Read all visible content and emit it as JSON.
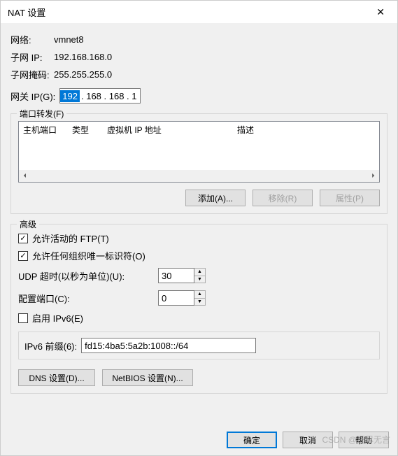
{
  "title": "NAT 设置",
  "close_icon": "✕",
  "network": {
    "label": "网络:",
    "value": "vmnet8"
  },
  "subnet_ip": {
    "label": "子网 IP:",
    "value": "192.168.168.0"
  },
  "subnet_mask": {
    "label": "子网掩码:",
    "value": "255.255.255.0"
  },
  "gateway": {
    "label": "网关 IP(G):",
    "seg0": "192",
    "rest": " . 168 . 168 .   1"
  },
  "port_forward": {
    "legend": "端口转发(F)",
    "headers": {
      "host_port": "主机端口",
      "type": "类型",
      "vm_ip": "虚拟机 IP 地址",
      "desc": "描述"
    },
    "buttons": {
      "add": "添加(A)...",
      "remove": "移除(R)",
      "props": "属性(P)"
    }
  },
  "advanced": {
    "legend": "高级",
    "ftp": "允许活动的 FTP(T)",
    "oui": "允许任何组织唯一标识符(O)",
    "udp_label": "UDP 超时(以秒为单位)(U):",
    "udp_value": "30",
    "cfg_port_label": "配置端口(C):",
    "cfg_port_value": "0",
    "ipv6_enable": "启用 IPv6(E)",
    "ipv6_prefix_label": "IPv6 前缀(6):",
    "ipv6_prefix_value": "fd15:4ba5:5a2b:1008::/64",
    "dns_btn": "DNS 设置(D)...",
    "netbios_btn": "NetBIOS 设置(N)..."
  },
  "bottom": {
    "ok": "确定",
    "cancel": "取消",
    "help": "帮助"
  },
  "watermark": "CSDN @语尽无言"
}
